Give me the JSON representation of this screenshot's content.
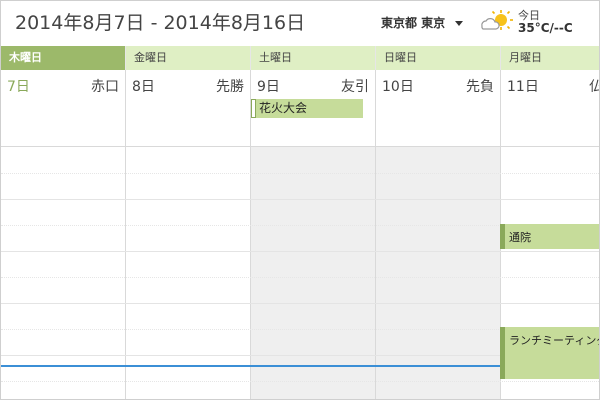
{
  "header": {
    "date_range": "2014年8月7日 - 2014年8月16日",
    "location": "東京都 東京",
    "weather_today_label": "今日",
    "weather_temp": "35°C/--C",
    "weather_icon": "partly-sunny-icon"
  },
  "days": [
    {
      "weekday": "木曜日",
      "date": "7日",
      "rokuyo": "赤口",
      "selected": true
    },
    {
      "weekday": "金曜日",
      "date": "8日",
      "rokuyo": "先勝"
    },
    {
      "weekday": "土曜日",
      "date": "9日",
      "rokuyo": "友引"
    },
    {
      "weekday": "日曜日",
      "date": "10日",
      "rokuyo": "先負"
    },
    {
      "weekday": "月曜日",
      "date": "11日",
      "rokuyo": "仏"
    }
  ],
  "all_day_events": [
    {
      "title": "花火大会",
      "day": "土曜日"
    }
  ],
  "timed_events": [
    {
      "title": "通院",
      "day": "月曜日"
    },
    {
      "title": "ランチミーティング",
      "day": "月曜日"
    }
  ],
  "colors": {
    "accent": "#9cb96a",
    "header_band": "#dfefc4",
    "event_fill": "#c6dc9a",
    "event_stripe": "#8aa95a",
    "now_line": "#3b8fd6",
    "weekend_fill": "#efefef"
  }
}
